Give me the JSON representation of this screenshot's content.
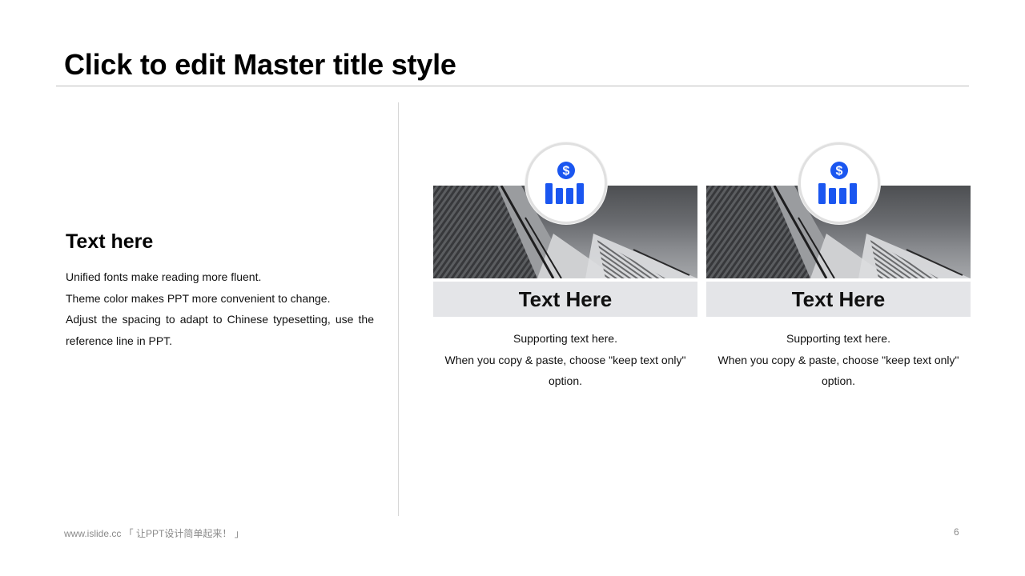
{
  "slide": {
    "title": "Click to edit Master title style",
    "page_number": "6",
    "footer": "www.islide.cc 「 让PPT设计简单起来！ 」"
  },
  "left": {
    "heading": "Text here",
    "paragraphs": [
      "Unified fonts make reading more fluent.",
      "Theme color makes PPT more convenient to change.",
      "Adjust the spacing to adapt to Chinese typesetting, use the reference line in PPT."
    ]
  },
  "cards": [
    {
      "icon": "dollar-bar-chart-icon",
      "title": "Text Here",
      "lines": [
        "Supporting text here.",
        "When you copy & paste, choose \"keep text only\" option."
      ]
    },
    {
      "icon": "dollar-bar-chart-icon",
      "title": "Text Here",
      "lines": [
        "Supporting text here.",
        "When you copy & paste, choose \"keep text only\" option."
      ]
    }
  ],
  "colors": {
    "accent": "#1a56f0",
    "band": "#e4e5e8",
    "rule": "#bdbdbd"
  }
}
